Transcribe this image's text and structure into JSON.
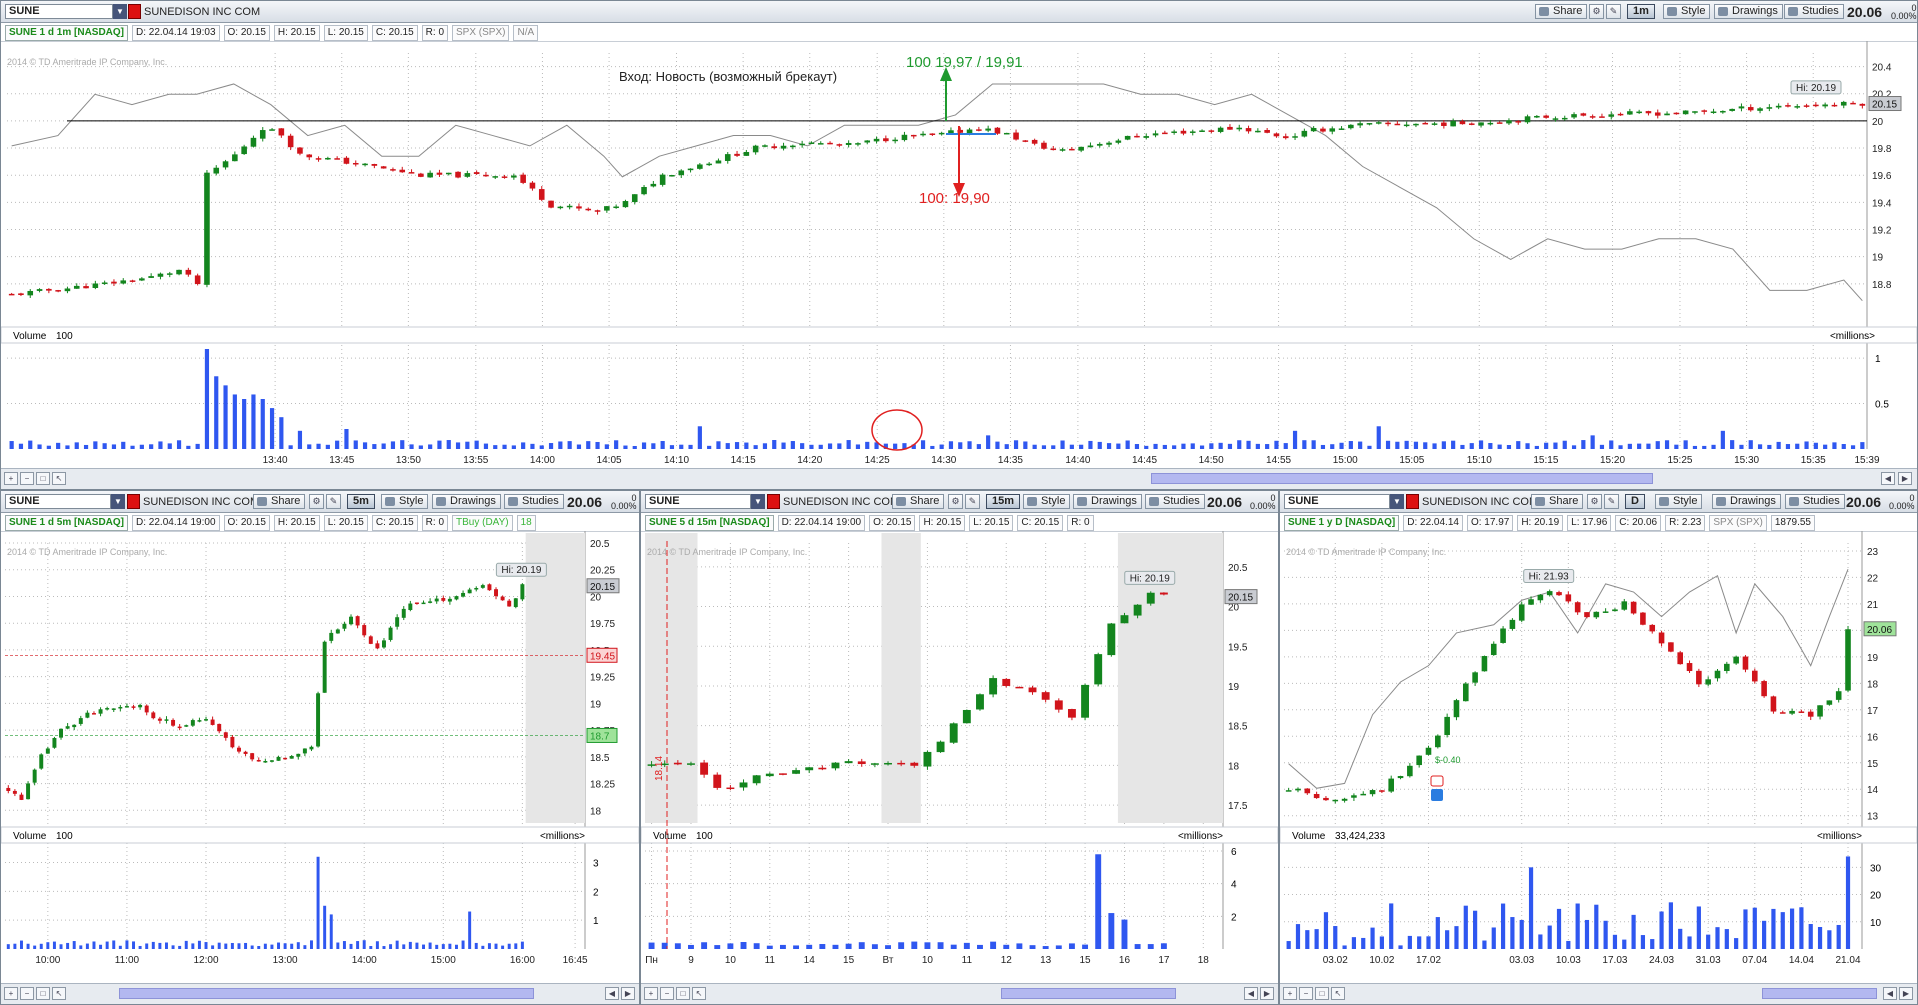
{
  "colors": {
    "up": "#13851e",
    "down": "#d1141b",
    "volume": "#2f57f0",
    "hline": "#000000",
    "compare": "#8a8a8a",
    "accent": "#1f9a2f"
  },
  "panels": [
    {
      "id": "main",
      "symbol": "SUNE",
      "company": "SUNEDISON INC COM",
      "tf": "1m",
      "price": "20.06",
      "pct": "0\n0.00%",
      "buttons": {
        "share": "Share",
        "style": "Style",
        "drawings": "Drawings",
        "studies": "Studies"
      },
      "info": [
        "SUNE 1 d 1m [NASDAQ]",
        "D: 22.04.14 19:03",
        "O: 20.15",
        "H: 20.15",
        "L: 20.15",
        "C: 20.15",
        "R: 0",
        "SPX (SPX)",
        "N/A"
      ],
      "watermark": "2014 © TD Ameritrade IP Company, Inc.",
      "vol_label": "Volume",
      "vol_value": "100",
      "vol_units": "<millions>"
    },
    {
      "id": "p5m",
      "symbol": "SUNE",
      "company": "SUNEDISON INC COM",
      "tf": "5m",
      "price": "20.06",
      "pct": "0\n0.00%",
      "buttons": {
        "share": "Share",
        "style": "Style",
        "drawings": "Drawings",
        "studies": "Studies"
      },
      "info": [
        "SUNE 1 d 5m [NASDAQ]",
        "D: 22.04.14 19:00",
        "O: 20.15",
        "H: 20.15",
        "L: 20.15",
        "C: 20.15",
        "R: 0",
        "TBuy (DAY)",
        "18"
      ],
      "watermark": "2014 © TD Ameritrade IP Company, Inc.",
      "vol_label": "Volume",
      "vol_value": "100",
      "vol_units": "<millions>"
    },
    {
      "id": "p15m",
      "symbol": "SUNE",
      "company": "SUNEDISON INC COM",
      "tf": "15m",
      "price": "20.06",
      "pct": "0\n0.00%",
      "buttons": {
        "share": "Share",
        "style": "Style",
        "drawings": "Drawings",
        "studies": "Studies"
      },
      "info": [
        "SUNE 5 d 15m [NASDAQ]",
        "D: 22.04.14 19:00",
        "O: 20.15",
        "H: 20.15",
        "L: 20.15",
        "C: 20.15",
        "R: 0"
      ],
      "watermark": "2014 © TD Ameritrade IP Company, Inc.",
      "vol_label": "Volume",
      "vol_value": "100",
      "vol_units": "<millions>"
    },
    {
      "id": "pD",
      "symbol": "SUNE",
      "company": "SUNEDISON INC COM",
      "tf": "D",
      "price": "20.06",
      "pct": "0\n0.00%",
      "buttons": {
        "share": "Share",
        "style": "Style",
        "drawings": "Drawings",
        "studies": "Studies"
      },
      "info": [
        "SUNE 1 y D [NASDAQ]",
        "D: 22.04.14",
        "O: 17.97",
        "H: 20.19",
        "L: 17.96",
        "C: 20.06",
        "R: 2.23",
        "SPX (SPX)",
        "1879.55"
      ],
      "watermark": "2014 © TD Ameritrade IP Company, Inc.",
      "vol_label": "Volume",
      "vol_value": "33,424,233",
      "vol_units": "<millions>"
    }
  ],
  "chart_data": [
    {
      "id": "main",
      "type": "candlestick",
      "interval": "1m",
      "ylim": [
        18.6,
        20.5
      ],
      "hline": 20.0,
      "xrange": [
        13.333,
        15.65
      ],
      "y_ticks": [
        18.8,
        19,
        19.2,
        19.4,
        19.6,
        19.8,
        20,
        20.2,
        20.4
      ],
      "x_ticks": [
        {
          "t": 13.667,
          "l": "13:40"
        },
        {
          "t": 13.75,
          "l": "13:45"
        },
        {
          "t": 13.833,
          "l": "13:50"
        },
        {
          "t": 13.917,
          "l": "13:55"
        },
        {
          "t": 14.0,
          "l": "14:00"
        },
        {
          "t": 14.083,
          "l": "14:05"
        },
        {
          "t": 14.167,
          "l": "14:10"
        },
        {
          "t": 14.25,
          "l": "14:15"
        },
        {
          "t": 14.333,
          "l": "14:20"
        },
        {
          "t": 14.417,
          "l": "14:25"
        },
        {
          "t": 14.5,
          "l": "14:30"
        },
        {
          "t": 14.583,
          "l": "14:35"
        },
        {
          "t": 14.667,
          "l": "14:40"
        },
        {
          "t": 14.75,
          "l": "14:45"
        },
        {
          "t": 14.833,
          "l": "14:50"
        },
        {
          "t": 14.917,
          "l": "14:55"
        },
        {
          "t": 15.0,
          "l": "15:00"
        },
        {
          "t": 15.083,
          "l": "15:05"
        },
        {
          "t": 15.167,
          "l": "15:10"
        },
        {
          "t": 15.25,
          "l": "15:15"
        },
        {
          "t": 15.333,
          "l": "15:20"
        },
        {
          "t": 15.417,
          "l": "15:25"
        },
        {
          "t": 15.5,
          "l": "15:30"
        },
        {
          "t": 15.583,
          "l": "15:35"
        },
        {
          "t": 15.65,
          "l": "15:39"
        }
      ],
      "anchors": [
        [
          0,
          18.72
        ],
        [
          10,
          18.8
        ],
        [
          15,
          18.85
        ],
        [
          18,
          18.9
        ],
        [
          20,
          18.8
        ],
        [
          21,
          19.6
        ],
        [
          24,
          19.75
        ],
        [
          27,
          19.95
        ],
        [
          29,
          19.9
        ],
        [
          31,
          19.75
        ],
        [
          34,
          19.72
        ],
        [
          40,
          19.65
        ],
        [
          44,
          19.6
        ],
        [
          50,
          19.6
        ],
        [
          54,
          19.6
        ],
        [
          58,
          19.38
        ],
        [
          63,
          19.33
        ],
        [
          66,
          19.4
        ],
        [
          70,
          19.6
        ],
        [
          75,
          19.7
        ],
        [
          80,
          19.8
        ],
        [
          85,
          19.84
        ],
        [
          90,
          19.82
        ],
        [
          95,
          19.88
        ],
        [
          100,
          19.9
        ],
        [
          104,
          19.95
        ],
        [
          107,
          19.9
        ],
        [
          110,
          19.82
        ],
        [
          113,
          19.78
        ],
        [
          118,
          19.85
        ],
        [
          122,
          19.9
        ],
        [
          128,
          19.93
        ],
        [
          132,
          19.95
        ],
        [
          137,
          19.88
        ],
        [
          140,
          19.93
        ],
        [
          145,
          19.97
        ],
        [
          150,
          19.98
        ],
        [
          155,
          19.98
        ],
        [
          160,
          20.0
        ],
        [
          165,
          20.03
        ],
        [
          172,
          20.05
        ],
        [
          180,
          20.06
        ],
        [
          190,
          20.11
        ],
        [
          200,
          20.13
        ]
      ],
      "candle_count": 200,
      "volume_ylim": [
        0,
        1.1
      ],
      "volume_ticks": [
        0.5,
        1
      ],
      "volume_spikes": [
        [
          21,
          1.1
        ],
        [
          22,
          0.8
        ],
        [
          23,
          0.7
        ],
        [
          24,
          0.6
        ],
        [
          25,
          0.55
        ],
        [
          26,
          0.6
        ],
        [
          27,
          0.55
        ],
        [
          28,
          0.45
        ],
        [
          29,
          0.35
        ],
        [
          31,
          0.2
        ],
        [
          36,
          0.22
        ],
        [
          74,
          0.25
        ],
        [
          105,
          0.15
        ],
        [
          138,
          0.2
        ],
        [
          147,
          0.25
        ],
        [
          170,
          0.15
        ],
        [
          184,
          0.2
        ]
      ],
      "compare_ylim": [
        1860,
        1885
      ],
      "compare": [
        [
          0,
          1876
        ],
        [
          5,
          1877
        ],
        [
          9,
          1881
        ],
        [
          13,
          1880
        ],
        [
          17,
          1881
        ],
        [
          20,
          1881
        ],
        [
          24,
          1882
        ],
        [
          28,
          1880
        ],
        [
          32,
          1877
        ],
        [
          36,
          1878
        ],
        [
          40,
          1875
        ],
        [
          44,
          1875
        ],
        [
          48,
          1878
        ],
        [
          52,
          1877
        ],
        [
          56,
          1876
        ],
        [
          60,
          1878
        ],
        [
          64,
          1875
        ],
        [
          66,
          1873
        ],
        [
          70,
          1875
        ],
        [
          74,
          1876
        ],
        [
          78,
          1877
        ],
        [
          82,
          1877
        ],
        [
          86,
          1876
        ],
        [
          90,
          1878
        ],
        [
          94,
          1878
        ],
        [
          98,
          1878
        ],
        [
          102,
          1879
        ],
        [
          106,
          1882
        ],
        [
          110,
          1882
        ],
        [
          114,
          1882
        ],
        [
          118,
          1882
        ],
        [
          122,
          1881
        ],
        [
          126,
          1881
        ],
        [
          130,
          1880
        ],
        [
          134,
          1881
        ],
        [
          138,
          1879
        ],
        [
          142,
          1877
        ],
        [
          146,
          1874
        ],
        [
          150,
          1872
        ],
        [
          154,
          1870
        ],
        [
          158,
          1867
        ],
        [
          162,
          1865
        ],
        [
          166,
          1867
        ],
        [
          170,
          1866
        ],
        [
          174,
          1866
        ],
        [
          178,
          1867
        ],
        [
          182,
          1867
        ],
        [
          186,
          1866
        ],
        [
          190,
          1862
        ],
        [
          194,
          1862
        ],
        [
          198,
          1863
        ],
        [
          200,
          1861
        ]
      ],
      "hi_label": "Hi: 20.19",
      "last_label": "20.15",
      "texts": {
        "entry": "Вход:  Новость (возможный брекаут)",
        "buy": "100   19,97 / 19,91",
        "sell": "100:  19,90"
      }
    },
    {
      "id": "p5m",
      "type": "candlestick",
      "interval": "5m",
      "ylim": [
        17.9,
        20.5
      ],
      "y_ticks": [
        18,
        18.25,
        18.5,
        18.75,
        19,
        19.25,
        19.5,
        19.75,
        20,
        20.25,
        20.5
      ],
      "x_ticks": [
        {
          "i": 6,
          "l": "10:00"
        },
        {
          "i": 18,
          "l": "11:00"
        },
        {
          "i": 30,
          "l": "12:00"
        },
        {
          "i": 42,
          "l": "13:00"
        },
        {
          "i": 54,
          "l": "14:00"
        },
        {
          "i": 66,
          "l": "15:00"
        },
        {
          "i": 78,
          "l": "16:00"
        },
        {
          "i": 86,
          "l": "16:45"
        }
      ],
      "candle_count": 79,
      "n_slots": 88,
      "anchors": [
        [
          0,
          18.2
        ],
        [
          2,
          18.1
        ],
        [
          5,
          18.5
        ],
        [
          8,
          18.75
        ],
        [
          12,
          18.9
        ],
        [
          16,
          18.95
        ],
        [
          20,
          19.0
        ],
        [
          22,
          18.85
        ],
        [
          26,
          18.8
        ],
        [
          30,
          18.85
        ],
        [
          34,
          18.6
        ],
        [
          38,
          18.45
        ],
        [
          42,
          18.5
        ],
        [
          46,
          18.6
        ],
        [
          48,
          19.6
        ],
        [
          52,
          19.8
        ],
        [
          56,
          19.5
        ],
        [
          60,
          19.9
        ],
        [
          64,
          19.95
        ],
        [
          68,
          20.0
        ],
        [
          72,
          20.1
        ],
        [
          76,
          19.9
        ],
        [
          78,
          20.1
        ]
      ],
      "hi_label": "Hi: 20.19",
      "last_label": "20.15",
      "levels": [
        {
          "v": 19.45,
          "c": "#d1141b",
          "l": "19.45"
        },
        {
          "v": 18.7,
          "c": "#1f9a2f",
          "l": "18.7"
        }
      ],
      "volume_ylim": [
        0,
        3.4
      ],
      "volume_ticks": [
        1,
        2,
        3
      ],
      "volume_spikes": [
        [
          47,
          3.2
        ],
        [
          48,
          1.5
        ],
        [
          49,
          1.2
        ],
        [
          70,
          1.3
        ]
      ]
    },
    {
      "id": "p15m",
      "type": "candlestick",
      "interval": "15m",
      "ylim": [
        17.3,
        20.8
      ],
      "y_ticks": [
        17.5,
        18,
        18.5,
        19,
        19.5,
        20,
        20.5
      ],
      "x_ticks": [
        {
          "i": 0,
          "l": "Пн"
        },
        {
          "i": 3,
          "l": "9"
        },
        {
          "i": 6,
          "l": "10"
        },
        {
          "i": 9,
          "l": "11"
        },
        {
          "i": 12,
          "l": "14"
        },
        {
          "i": 15,
          "l": "15"
        },
        {
          "i": 18,
          "l": "Вт"
        },
        {
          "i": 21,
          "l": "10"
        },
        {
          "i": 24,
          "l": "11"
        },
        {
          "i": 27,
          "l": "12"
        },
        {
          "i": 30,
          "l": "13"
        },
        {
          "i": 33,
          "l": "15"
        },
        {
          "i": 36,
          "l": "16"
        },
        {
          "i": 39,
          "l": "17"
        },
        {
          "i": 42,
          "l": "18"
        }
      ],
      "candle_count": 40,
      "n_slots": 44,
      "anchors": [
        [
          0,
          18.0
        ],
        [
          3,
          18.0
        ],
        [
          5,
          17.7
        ],
        [
          8,
          17.85
        ],
        [
          12,
          17.95
        ],
        [
          16,
          18.05
        ],
        [
          20,
          18.0
        ],
        [
          23,
          18.5
        ],
        [
          26,
          19.1
        ],
        [
          29,
          18.9
        ],
        [
          32,
          18.6
        ],
        [
          35,
          19.8
        ],
        [
          38,
          20.15
        ],
        [
          40,
          20.1
        ]
      ],
      "hi_label": "Hi: 20.19",
      "last_label": "20.15",
      "marker": "18.14",
      "volume_ylim": [
        0,
        6
      ],
      "volume_ticks": [
        2,
        4,
        6
      ],
      "volume_spikes": [
        [
          34,
          5.8
        ],
        [
          35,
          2.2
        ],
        [
          36,
          1.8
        ]
      ]
    },
    {
      "id": "pD",
      "type": "candlestick",
      "interval": "D",
      "ylim": [
        12.8,
        23.3
      ],
      "y_ticks": [
        13,
        14,
        15,
        16,
        17,
        18,
        19,
        20,
        21,
        22,
        23
      ],
      "x_ticks": [
        {
          "i": 5,
          "l": "03.02"
        },
        {
          "i": 10,
          "l": "10.02"
        },
        {
          "i": 15,
          "l": "17.02"
        },
        {
          "i": 25,
          "l": "03.03"
        },
        {
          "i": 30,
          "l": "10.03"
        },
        {
          "i": 35,
          "l": "17.03"
        },
        {
          "i": 40,
          "l": "24.03"
        },
        {
          "i": 45,
          "l": "31.03"
        },
        {
          "i": 50,
          "l": "07.04"
        },
        {
          "i": 55,
          "l": "14.04"
        },
        {
          "i": 60,
          "l": "21.04"
        }
      ],
      "candle_count": 61,
      "n_slots": 62,
      "anchors": [
        [
          0,
          14.0
        ],
        [
          5,
          13.6
        ],
        [
          10,
          14.0
        ],
        [
          15,
          15.5
        ],
        [
          20,
          18.5
        ],
        [
          25,
          21.0
        ],
        [
          28,
          21.5
        ],
        [
          32,
          20.5
        ],
        [
          36,
          21.0
        ],
        [
          40,
          19.5
        ],
        [
          44,
          18.0
        ],
        [
          48,
          19.0
        ],
        [
          52,
          17.0
        ],
        [
          56,
          16.8
        ],
        [
          59,
          17.7
        ],
        [
          60,
          20.06
        ]
      ],
      "hi_label": "Hi: 21.93",
      "last_label": "20.06",
      "earn_label": "$-0.40",
      "compare_ylim": [
        1725,
        1895
      ],
      "compare": [
        [
          0,
          1760
        ],
        [
          3,
          1745
        ],
        [
          6,
          1748
        ],
        [
          9,
          1790
        ],
        [
          12,
          1810
        ],
        [
          15,
          1820
        ],
        [
          18,
          1840
        ],
        [
          22,
          1845
        ],
        [
          25,
          1860
        ],
        [
          28,
          1865
        ],
        [
          31,
          1840
        ],
        [
          34,
          1870
        ],
        [
          37,
          1865
        ],
        [
          40,
          1850
        ],
        [
          43,
          1865
        ],
        [
          46,
          1875
        ],
        [
          48,
          1840
        ],
        [
          50,
          1870
        ],
        [
          53,
          1850
        ],
        [
          56,
          1820
        ],
        [
          58,
          1850
        ],
        [
          60,
          1879
        ]
      ],
      "volume_ylim": [
        0,
        36
      ],
      "volume_ticks": [
        10,
        20,
        30
      ],
      "volume_spikes": [
        [
          26,
          30
        ],
        [
          60,
          34
        ]
      ]
    }
  ]
}
